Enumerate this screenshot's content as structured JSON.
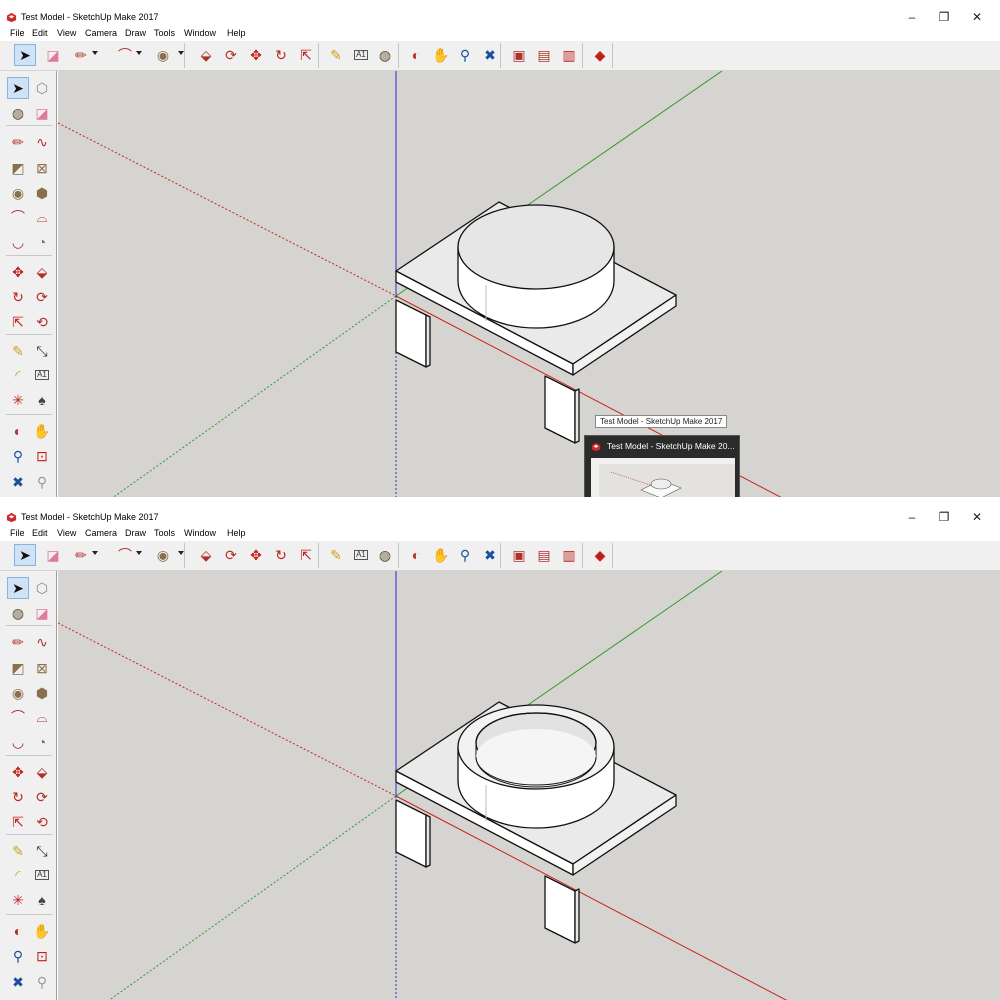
{
  "app": {
    "title": "Test Model - SketchUp Make 2017",
    "window_controls": {
      "minimize": "–",
      "restore": "❐",
      "close": "✕"
    },
    "menus": [
      "File",
      "Edit",
      "View",
      "Camera",
      "Draw",
      "Tools",
      "Window",
      "Help"
    ]
  },
  "toolbar": [
    {
      "name": "select-tool-button",
      "glyph": "➤",
      "color": "#111111",
      "active": true
    },
    {
      "name": "eraser-tool-button",
      "glyph": "◪",
      "color": "#e07a9a"
    },
    {
      "name": "line-tool-button",
      "glyph": "✏",
      "color": "#b0302a",
      "dropdown": true
    },
    {
      "name": "arc-tool-button",
      "glyph": "⌒",
      "color": "#b0302a",
      "dropdown": true
    },
    {
      "name": "circle-tool-button",
      "glyph": "◉",
      "color": "#8a6f4c",
      "dropdown": true
    },
    {
      "name": "push-pull-tool-button",
      "glyph": "⬙",
      "color": "#b0302a"
    },
    {
      "name": "follow-me-tool-button",
      "glyph": "⟳",
      "color": "#b0302a"
    },
    {
      "name": "move-tool-button",
      "glyph": "✥",
      "color": "#c0201a"
    },
    {
      "name": "rotate-tool-button",
      "glyph": "↻",
      "color": "#c0201a"
    },
    {
      "name": "scale-tool-button",
      "glyph": "⇱",
      "color": "#c0201a"
    },
    {
      "name": "tape-measure-tool-button",
      "glyph": "✎",
      "color": "#c9a21f"
    },
    {
      "name": "text-tool-button",
      "glyph": "A",
      "color": "#333333"
    },
    {
      "name": "paint-bucket-tool-button",
      "glyph": "◍",
      "color": "#5c4b2a"
    },
    {
      "name": "orbit-tool-button",
      "glyph": "◐",
      "color": "#b0302a"
    },
    {
      "name": "pan-tool-button",
      "glyph": "✋",
      "color": "#d4a050"
    },
    {
      "name": "zoom-tool-button",
      "glyph": "⚲",
      "color": "#1a4fa0"
    },
    {
      "name": "zoom-extents-tool-button",
      "glyph": "✖",
      "color": "#1a4fa0"
    },
    {
      "name": "warehouse-button",
      "glyph": "▣",
      "color": "#b0302a"
    },
    {
      "name": "share-model-button",
      "glyph": "▤",
      "color": "#b0302a"
    },
    {
      "name": "extension-warehouse-button",
      "glyph": "▥",
      "color": "#c0201a"
    },
    {
      "name": "ruby-console-button",
      "glyph": "◆",
      "color": "#c0201a"
    }
  ],
  "left_tools": [
    {
      "name": "select-tool-button",
      "glyph": "➤",
      "color": "#111111",
      "active": true
    },
    {
      "name": "make-component-button",
      "glyph": "⬡",
      "color": "#888888"
    },
    {
      "name": "paint-bucket-tool-button",
      "glyph": "◍",
      "color": "#5c4b2a"
    },
    {
      "name": "eraser-tool-button",
      "glyph": "◪",
      "color": "#e07a9a"
    },
    {
      "name": "line-tool-button",
      "glyph": "✏",
      "color": "#b0302a"
    },
    {
      "name": "freehand-tool-button",
      "glyph": "∿",
      "color": "#b0302a"
    },
    {
      "name": "rectangle-tool-button",
      "glyph": "◩",
      "color": "#8a6f4c"
    },
    {
      "name": "rotated-rectangle-tool-button",
      "glyph": "⊠",
      "color": "#8a6f4c"
    },
    {
      "name": "circle-tool-button",
      "glyph": "◉",
      "color": "#8a6f4c"
    },
    {
      "name": "polygon-tool-button",
      "glyph": "⬢",
      "color": "#8a6f4c"
    },
    {
      "name": "arc-tool-button",
      "glyph": "⌒",
      "color": "#b0302a"
    },
    {
      "name": "two-point-arc-tool-button",
      "glyph": "⌓",
      "color": "#b0302a"
    },
    {
      "name": "three-point-arc-tool-button",
      "glyph": "◡",
      "color": "#b0302a"
    },
    {
      "name": "pie-tool-button",
      "glyph": "◔",
      "color": "#8a6f4c"
    },
    {
      "name": "move-tool-button",
      "glyph": "✥",
      "color": "#c0201a"
    },
    {
      "name": "push-pull-tool-button",
      "glyph": "⬙",
      "color": "#b0302a"
    },
    {
      "name": "rotate-tool-button",
      "glyph": "↻",
      "color": "#c0201a"
    },
    {
      "name": "follow-me-tool-button",
      "glyph": "⟳",
      "color": "#b0302a"
    },
    {
      "name": "scale-tool-button",
      "glyph": "⇱",
      "color": "#c0201a"
    },
    {
      "name": "offset-tool-button",
      "glyph": "⟲",
      "color": "#b0302a"
    },
    {
      "name": "tape-measure-tool-button",
      "glyph": "✎",
      "color": "#c9a21f"
    },
    {
      "name": "dimension-tool-button",
      "glyph": "⤡",
      "color": "#333333"
    },
    {
      "name": "protractor-tool-button",
      "glyph": "◜",
      "color": "#c9a21f"
    },
    {
      "name": "text-tool-button",
      "glyph": "A",
      "color": "#333333"
    },
    {
      "name": "axes-tool-button",
      "glyph": "✳",
      "color": "#c0201a"
    },
    {
      "name": "3d-text-tool-button",
      "glyph": "♠",
      "color": "#444444"
    },
    {
      "name": "orbit-tool-button",
      "glyph": "◐",
      "color": "#b0302a"
    },
    {
      "name": "pan-tool-button",
      "glyph": "✋",
      "color": "#d4a050"
    },
    {
      "name": "zoom-tool-button",
      "glyph": "⚲",
      "color": "#1a4fa0"
    },
    {
      "name": "zoom-window-tool-button",
      "glyph": "⊡",
      "color": "#c0201a"
    },
    {
      "name": "zoom-extents-tool-button",
      "glyph": "✖",
      "color": "#1a4fa0"
    },
    {
      "name": "previous-view-button",
      "glyph": "⚲",
      "color": "#9a9a9a"
    }
  ],
  "toolbar_text_tool_label": "A1",
  "taskbar_preview": {
    "tooltip": "Test Model - SketchUp Make 2017",
    "title": "Test Model - SketchUp Make 20..."
  },
  "colors": {
    "viewport_bg": "#d6d4d0",
    "red_axis": "#c8231d",
    "green_axis": "#2c9a2c",
    "blue_axis": "#2a2acc"
  }
}
